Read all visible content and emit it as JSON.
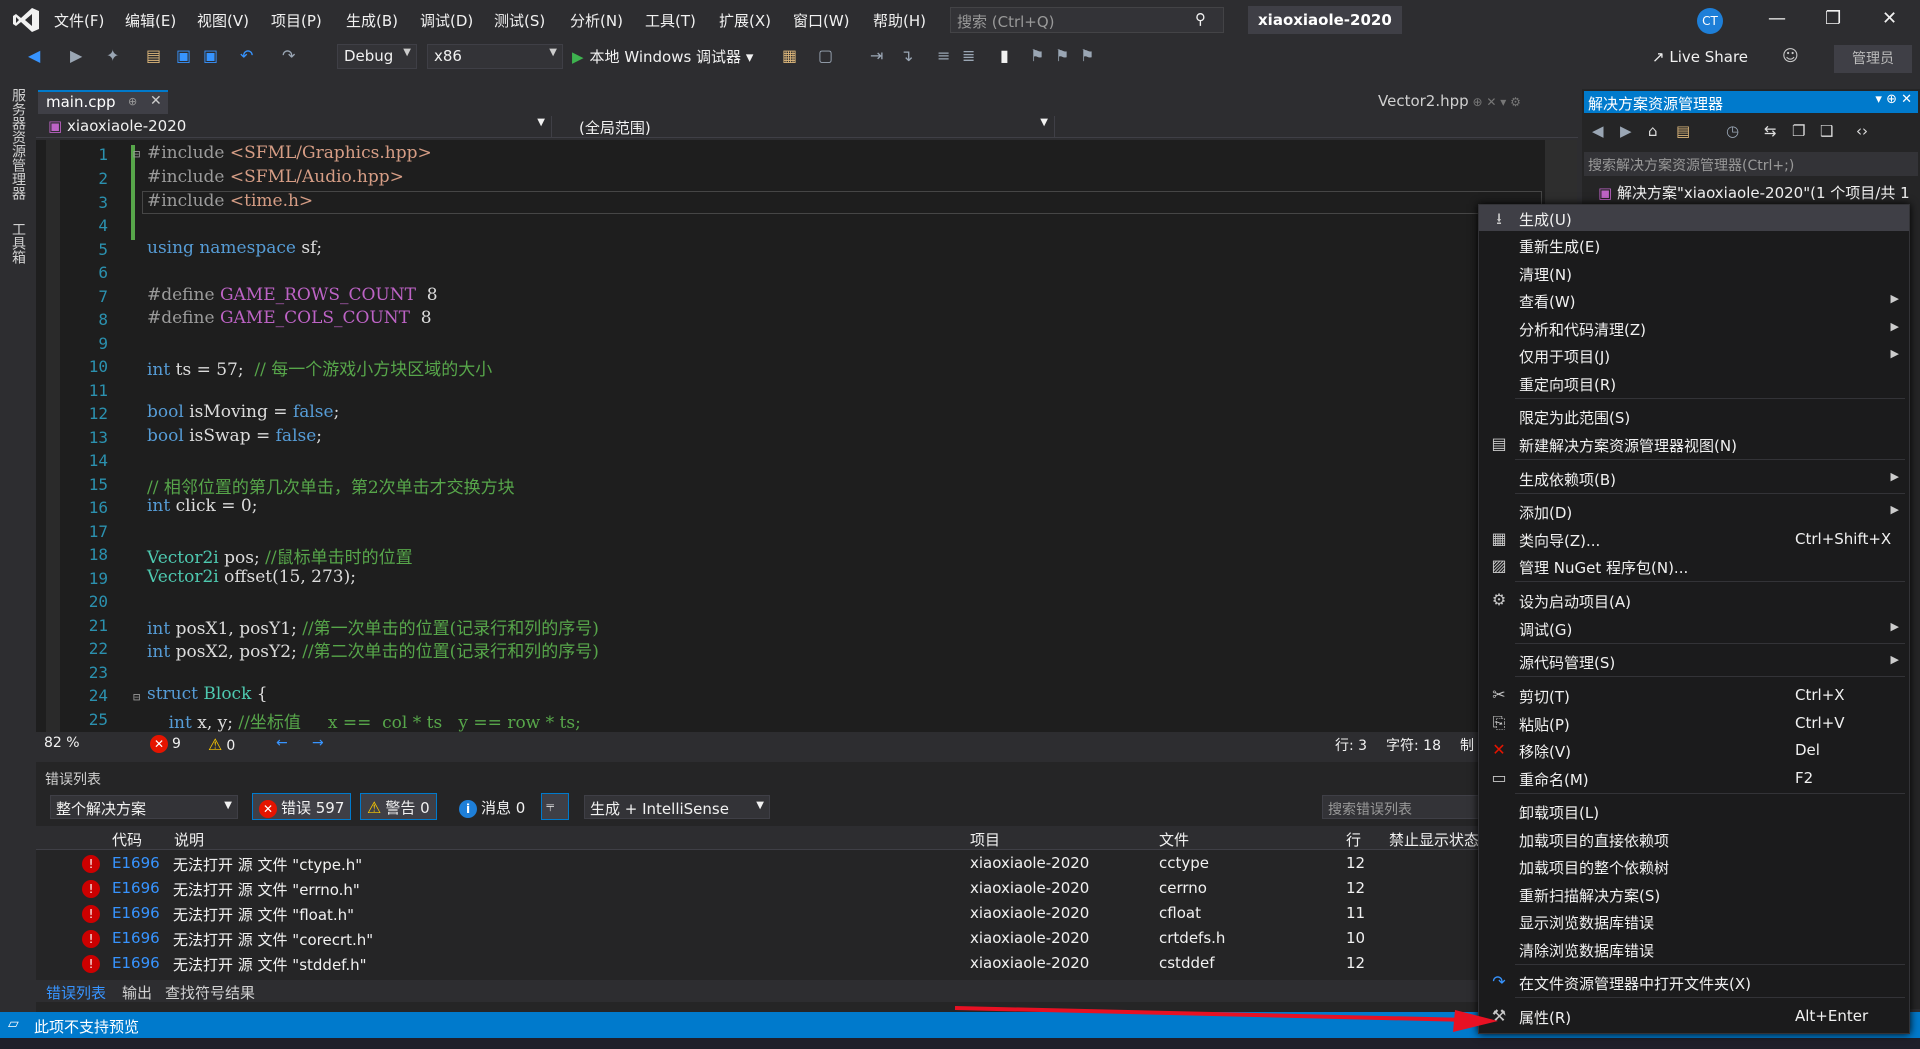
{
  "title_bar": {
    "menus": [
      "文件(F)",
      "编辑(E)",
      "视图(V)",
      "项目(P)",
      "生成(B)",
      "调试(D)",
      "测试(S)",
      "分析(N)",
      "工具(T)",
      "扩展(X)",
      "窗口(W)",
      "帮助(H)"
    ],
    "search_placeholder": "搜索 (Ctrl+Q)",
    "solution_name": "xiaoxiaole-2020",
    "avatar_initials": "CT"
  },
  "toolbar": {
    "config": "Debug",
    "platform": "x86",
    "run_label": "本地 Windows 调试器",
    "live_share": "Live Share",
    "admin_badge": "管理员"
  },
  "left_strip": {
    "server_explorer": "服务器资源管理器",
    "toolbox": "工具箱"
  },
  "editor": {
    "active_tab": "main.cpp",
    "other_tab": "Vector2.hpp",
    "nav_project": "xiaoxiaole-2020",
    "nav_scope": "(全局范围)",
    "line_numbers": [
      "1",
      "2",
      "3",
      "4",
      "5",
      "6",
      "7",
      "8",
      "9",
      "10",
      "11",
      "12",
      "13",
      "14",
      "15",
      "16",
      "17",
      "18",
      "19",
      "20",
      "21",
      "22",
      "23",
      "24",
      "25"
    ],
    "status": {
      "zoom": "82 %",
      "errors": "9",
      "warnings": "0",
      "line": "行: 3",
      "col": "字符: 18",
      "mode": "制"
    }
  },
  "error_list": {
    "title": "错误列表",
    "scope": "整个解决方案",
    "errors_btn": "错误 597",
    "warnings_btn": "警告 0",
    "messages_btn": "消息 0",
    "build_filter": "生成 + IntelliSense",
    "search_placeholder": "搜索错误列表",
    "columns": {
      "code": "代码",
      "desc": "说明",
      "project": "项目",
      "file": "文件",
      "line": "行",
      "suppress": "禁止显示状态"
    },
    "rows": [
      {
        "code": "E1696",
        "desc": "无法打开 源 文件 \"ctype.h\"",
        "project": "xiaoxiaole-2020",
        "file": "cctype",
        "line": "12"
      },
      {
        "code": "E1696",
        "desc": "无法打开 源 文件 \"errno.h\"",
        "project": "xiaoxiaole-2020",
        "file": "cerrno",
        "line": "12"
      },
      {
        "code": "E1696",
        "desc": "无法打开 源 文件 \"float.h\"",
        "project": "xiaoxiaole-2020",
        "file": "cfloat",
        "line": "11"
      },
      {
        "code": "E1696",
        "desc": "无法打开 源 文件 \"corecrt.h\"",
        "project": "xiaoxiaole-2020",
        "file": "crtdefs.h",
        "line": "10"
      },
      {
        "code": "E1696",
        "desc": "无法打开 源 文件 \"stddef.h\"",
        "project": "xiaoxiaole-2020",
        "file": "cstddef",
        "line": "12"
      }
    ],
    "bottom_tabs": [
      "错误列表",
      "输出",
      "查找符号结果"
    ]
  },
  "solution_explorer": {
    "title": "解决方案资源管理器",
    "search_placeholder": "搜索解决方案资源管理器(Ctrl+;)",
    "solution_node": "解决方案\"xiaoxiaole-2020\"(1 个项目/共 1"
  },
  "context_menu": {
    "items": [
      {
        "label": "生成(U)",
        "shortcut": "",
        "submenu": false
      },
      {
        "label": "重新生成(E)",
        "shortcut": "",
        "submenu": false
      },
      {
        "label": "清理(N)",
        "shortcut": "",
        "submenu": false
      },
      {
        "label": "查看(W)",
        "shortcut": "",
        "submenu": true
      },
      {
        "label": "分析和代码清理(Z)",
        "shortcut": "",
        "submenu": true
      },
      {
        "label": "仅用于项目(J)",
        "shortcut": "",
        "submenu": true
      },
      {
        "label": "重定向项目(R)",
        "shortcut": "",
        "submenu": false
      },
      {
        "label": "限定为此范围(S)",
        "shortcut": "",
        "submenu": false
      },
      {
        "label": "新建解决方案资源管理器视图(N)",
        "shortcut": "",
        "submenu": false
      },
      {
        "label": "生成依赖项(B)",
        "shortcut": "",
        "submenu": true
      },
      {
        "label": "添加(D)",
        "shortcut": "",
        "submenu": true
      },
      {
        "label": "类向导(Z)...",
        "shortcut": "Ctrl+Shift+X",
        "submenu": false
      },
      {
        "label": "管理 NuGet 程序包(N)...",
        "shortcut": "",
        "submenu": false
      },
      {
        "label": "设为启动项目(A)",
        "shortcut": "",
        "submenu": false
      },
      {
        "label": "调试(G)",
        "shortcut": "",
        "submenu": true
      },
      {
        "label": "源代码管理(S)",
        "shortcut": "",
        "submenu": true
      },
      {
        "label": "剪切(T)",
        "shortcut": "Ctrl+X",
        "submenu": false
      },
      {
        "label": "粘贴(P)",
        "shortcut": "Ctrl+V",
        "submenu": false
      },
      {
        "label": "移除(V)",
        "shortcut": "Del",
        "submenu": false
      },
      {
        "label": "重命名(M)",
        "shortcut": "F2",
        "submenu": false
      },
      {
        "label": "卸载项目(L)",
        "shortcut": "",
        "submenu": false
      },
      {
        "label": "加载项目的直接依赖项",
        "shortcut": "",
        "submenu": false
      },
      {
        "label": "加载项目的整个依赖树",
        "shortcut": "",
        "submenu": false
      },
      {
        "label": "重新扫描解决方案(S)",
        "shortcut": "",
        "submenu": false
      },
      {
        "label": "显示浏览数据库错误",
        "shortcut": "",
        "submenu": false
      },
      {
        "label": "清除浏览数据库错误",
        "shortcut": "",
        "submenu": false
      },
      {
        "label": "在文件资源管理器中打开文件夹(X)",
        "shortcut": "",
        "submenu": false
      },
      {
        "label": "属性(R)",
        "shortcut": "Alt+Enter",
        "submenu": false
      }
    ]
  },
  "status_bar": {
    "text": "此项不支持预览"
  },
  "colors": {
    "accent": "#007acc",
    "arrow": "#e81123"
  }
}
